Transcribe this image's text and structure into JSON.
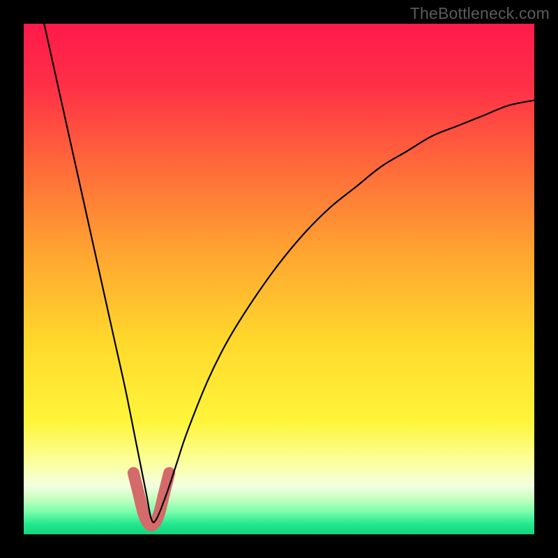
{
  "watermark": "TheBottleneck.com",
  "chart_data": {
    "type": "line",
    "title": "",
    "xlabel": "",
    "ylabel": "",
    "xlim": [
      0,
      100
    ],
    "ylim": [
      0,
      100
    ],
    "legend": false,
    "grid": false,
    "series": [
      {
        "name": "curve",
        "color": "#000000",
        "x": [
          4,
          6,
          8,
          10,
          12,
          14,
          16,
          18,
          20,
          22,
          24,
          25,
          26,
          28,
          30,
          32,
          36,
          40,
          45,
          50,
          55,
          60,
          65,
          70,
          75,
          80,
          85,
          90,
          95,
          100
        ],
        "y": [
          100,
          91,
          82,
          73,
          64,
          55,
          46,
          37,
          28,
          18,
          8,
          3,
          3,
          8,
          14,
          20,
          30,
          38,
          46,
          53,
          59,
          64,
          68,
          72,
          75,
          78,
          80,
          82,
          84,
          85
        ]
      },
      {
        "name": "highlight",
        "color": "#d46a6a",
        "x": [
          21.5,
          22.5,
          23.5,
          24.5,
          25.5,
          26.5,
          27.5,
          28.5
        ],
        "y": [
          12,
          8,
          4,
          2,
          2,
          4,
          8,
          12
        ]
      }
    ],
    "gradient_stops": [
      {
        "pos": 0.0,
        "color": "#ff1a4b"
      },
      {
        "pos": 0.12,
        "color": "#ff2f47"
      },
      {
        "pos": 0.28,
        "color": "#ff6a3a"
      },
      {
        "pos": 0.45,
        "color": "#ffa531"
      },
      {
        "pos": 0.62,
        "color": "#ffd82c"
      },
      {
        "pos": 0.78,
        "color": "#fff53a"
      },
      {
        "pos": 0.86,
        "color": "#fbffa0"
      },
      {
        "pos": 0.905,
        "color": "#f3ffe0"
      },
      {
        "pos": 0.93,
        "color": "#c7ffc0"
      },
      {
        "pos": 0.955,
        "color": "#7dffad"
      },
      {
        "pos": 0.98,
        "color": "#22e88e"
      },
      {
        "pos": 1.0,
        "color": "#12d57c"
      }
    ]
  }
}
